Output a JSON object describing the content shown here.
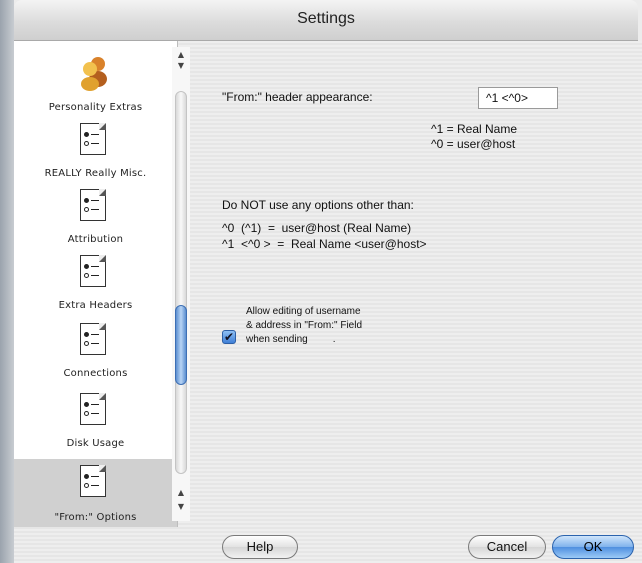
{
  "window": {
    "title": "Settings"
  },
  "sidebar": {
    "items": [
      {
        "label": "Personality Extras",
        "icon": "people-icon"
      },
      {
        "label": "REALLY Really Misc.",
        "icon": "document-icon"
      },
      {
        "label": "Attribution",
        "icon": "document-icon"
      },
      {
        "label": "Extra Headers",
        "icon": "document-icon"
      },
      {
        "label": "Connections",
        "icon": "document-icon"
      },
      {
        "label": "Disk Usage",
        "icon": "document-icon"
      },
      {
        "label": "\"From:\" Options",
        "icon": "document-icon",
        "selected": true
      }
    ]
  },
  "main": {
    "from_header_label": "\"From:\" header appearance:",
    "from_header_value": "^1 <^0>",
    "legend_line1": "^1 = Real Name",
    "legend_line2": "^0 = user@host",
    "warning": "Do NOT use any options other than:",
    "option_line1": "^0  (^1)  =  user@host (Real Name)",
    "option_line2": "^1  <^0 >  =  Real Name <user@host>",
    "checkbox": {
      "checked": true,
      "line1": "Allow editing of username",
      "line2": "& address in \"From:\" Field",
      "line3": "when sending         ."
    }
  },
  "footer": {
    "help_label": "Help",
    "cancel_label": "Cancel",
    "ok_label": "OK"
  },
  "colors": {
    "accent": "#4f8fe0",
    "selected_row": "#d0d0d0"
  }
}
